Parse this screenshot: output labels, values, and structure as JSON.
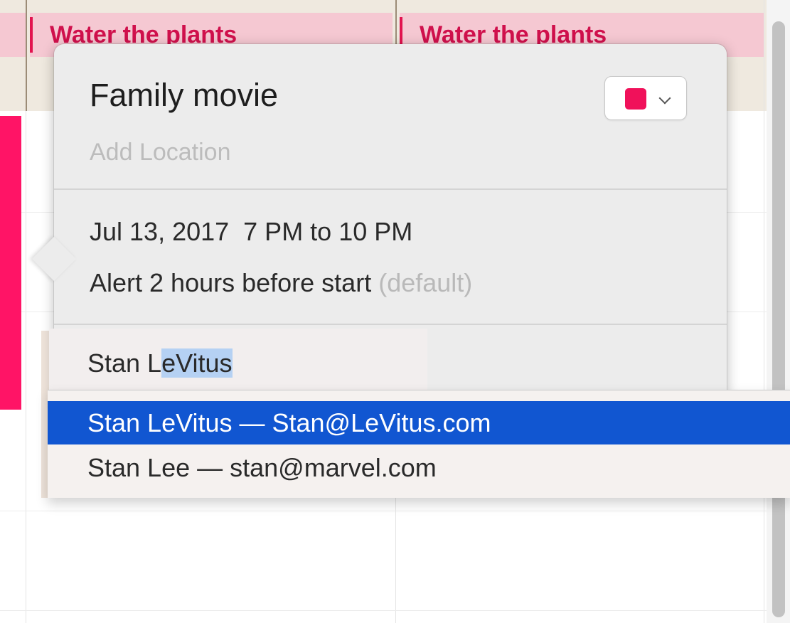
{
  "calendar": {
    "allday_events": [
      {
        "title": "Water the plants"
      },
      {
        "title": "Water the plants"
      }
    ],
    "accent_color": "#e2134f"
  },
  "popover": {
    "title": "Family movie",
    "location_placeholder": "Add Location",
    "calendar_color": "#f0115a",
    "datetime": "Jul 13, 2017  7 PM to 10 PM",
    "alert": "Alert 2 hours before start",
    "alert_suffix": "(default)",
    "invitee": {
      "typed": "Stan L",
      "autocompleted": "eVitus"
    }
  },
  "autocomplete": {
    "selected_color": "#1156d1",
    "items": [
      {
        "label": "Stan LeVitus — Stan@LeVitus.com",
        "selected": true
      },
      {
        "label": "Stan Lee — stan@marvel.com",
        "selected": false
      }
    ]
  }
}
